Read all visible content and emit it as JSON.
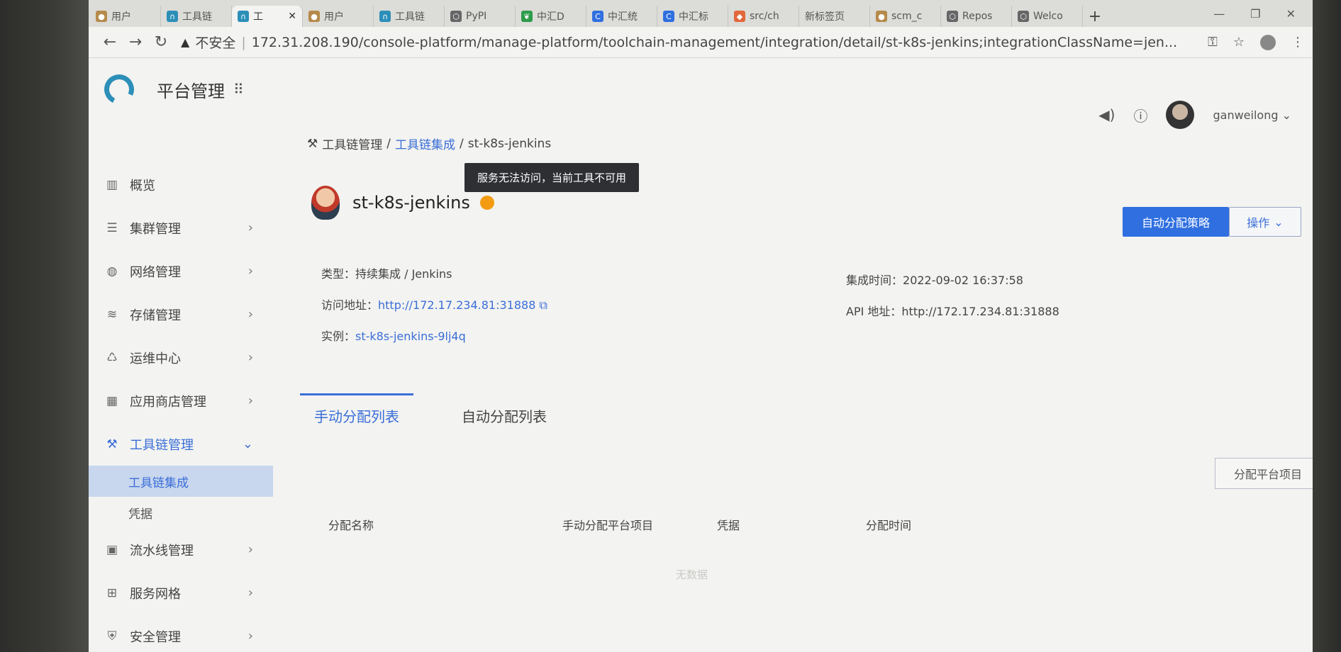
{
  "browser": {
    "tabs": [
      {
        "label": "用户",
        "icon": "user-icon",
        "active": false
      },
      {
        "label": "工具链",
        "icon": "platform-logo-icon",
        "active": false
      },
      {
        "label": "工",
        "icon": "platform-logo-icon",
        "active": true
      },
      {
        "label": "用户",
        "icon": "user-icon",
        "active": false
      },
      {
        "label": "工具链",
        "icon": "platform-logo-icon",
        "active": false
      },
      {
        "label": "PyPI",
        "icon": "hex-icon",
        "active": false
      },
      {
        "label": "中汇D",
        "icon": "green-leaf-icon",
        "active": false
      },
      {
        "label": "中汇统",
        "icon": "blue-c-icon",
        "active": false
      },
      {
        "label": "中汇标",
        "icon": "blue-c-icon",
        "active": false
      },
      {
        "label": "src/ch",
        "icon": "gitlab-icon",
        "active": false
      },
      {
        "label": "新标签页",
        "icon": "",
        "active": false
      },
      {
        "label": "scm_c",
        "icon": "user-icon",
        "active": false
      },
      {
        "label": "Repos",
        "icon": "hex-icon",
        "active": false
      },
      {
        "label": "Welco",
        "icon": "hex-icon",
        "active": false
      }
    ],
    "new_tab": "+",
    "security_label": "不安全",
    "url": "172.31.208.190/console-platform/manage-platform/toolchain-management/integration/detail/st-k8s-jenkins;integrationClassName=jen..."
  },
  "app": {
    "title": "平台管理",
    "username": "ganweilong"
  },
  "sidebar": {
    "items": [
      {
        "label": "概览",
        "icon": "bar-chart-icon",
        "has_children": false
      },
      {
        "label": "集群管理",
        "icon": "server-icon",
        "has_children": true
      },
      {
        "label": "网络管理",
        "icon": "globe-icon",
        "has_children": true
      },
      {
        "label": "存储管理",
        "icon": "database-icon",
        "has_children": true
      },
      {
        "label": "运维中心",
        "icon": "ops-icon",
        "has_children": true
      },
      {
        "label": "应用商店管理",
        "icon": "store-icon",
        "has_children": true
      },
      {
        "label": "工具链管理",
        "icon": "tools-icon",
        "has_children": true,
        "expanded": true
      },
      {
        "label": "流水线管理",
        "icon": "pipeline-icon",
        "has_children": true
      },
      {
        "label": "服务网格",
        "icon": "mesh-icon",
        "has_children": true
      },
      {
        "label": "安全管理",
        "icon": "shield-icon",
        "has_children": true
      }
    ],
    "sub_items": [
      {
        "label": "工具链集成",
        "active": true
      },
      {
        "label": "凭据",
        "active": false
      }
    ]
  },
  "breadcrumb": {
    "root": "工具链管理",
    "sep": "/",
    "mid": "工具链集成",
    "current": "st-k8s-jenkins"
  },
  "tooltip": "服务无法访问，当前工具不可用",
  "detail": {
    "name": "st-k8s-jenkins",
    "status_color": "#f39c12",
    "primary_button": "自动分配策略",
    "actions_button": "操作",
    "type_label": "类型：",
    "type_value": "持续集成 / Jenkins",
    "access_label": "访问地址：",
    "access_value": "http://172.17.234.81:31888",
    "instance_label": "实例：",
    "instance_value": "st-k8s-jenkins-9lj4q",
    "integrated_label": "集成时间：",
    "integrated_value": "2022-09-02 16:37:58",
    "api_label": "API 地址：",
    "api_value": "http://172.17.234.81:31888"
  },
  "tabs": {
    "manual": "手动分配列表",
    "auto": "自动分配列表"
  },
  "table": {
    "assign_button": "分配平台项目",
    "columns": [
      "分配名称",
      "手动分配平台项目",
      "凭据",
      "分配时间"
    ],
    "empty_text": "无数据"
  },
  "colors": {
    "accent": "#3a6ed8",
    "primary_button": "#2f6fe0",
    "logo": "#2c8fb8"
  }
}
